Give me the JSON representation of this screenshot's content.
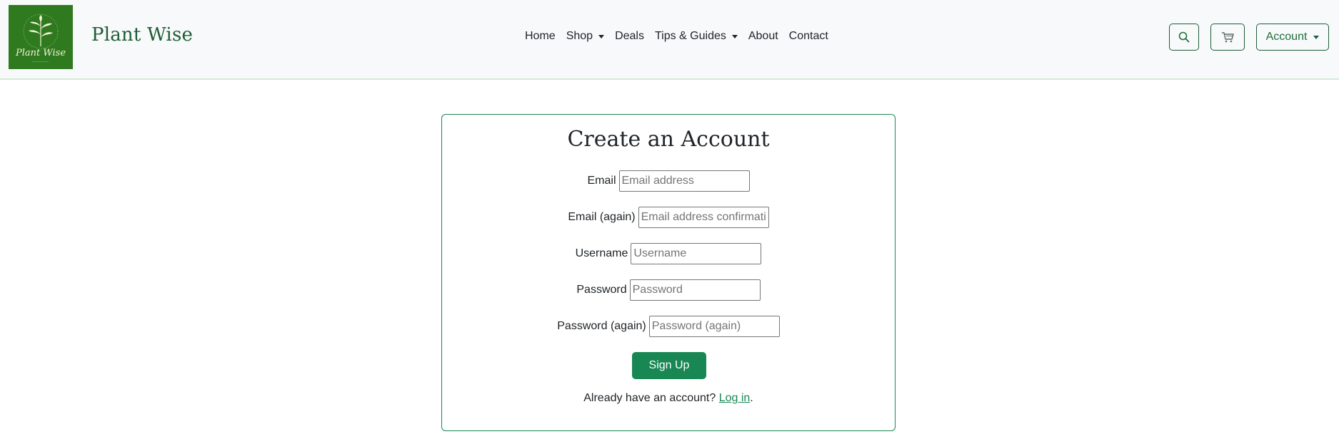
{
  "header": {
    "brand": "Plant Wise",
    "logo_text": "Plant Wise",
    "nav": [
      {
        "label": "Home"
      },
      {
        "label": "Shop"
      },
      {
        "label": "Deals"
      },
      {
        "label": "Tips & Guides"
      },
      {
        "label": "About"
      },
      {
        "label": "Contact"
      }
    ],
    "account_label": "Account",
    "icons": {
      "search": "search-icon",
      "cart": "cart-icon"
    },
    "colors": {
      "nav_bg": "#f8f9fa",
      "brand": "#1f5d36",
      "accent": "#198754",
      "logo_bg": "#2f7a1f"
    }
  },
  "form": {
    "title": "Create an Account",
    "fields": [
      {
        "label": "Email",
        "placeholder": "Email address"
      },
      {
        "label": "Email (again)",
        "placeholder": "Email address confirmation"
      },
      {
        "label": "Username",
        "placeholder": "Username"
      },
      {
        "label": "Password",
        "placeholder": "Password"
      },
      {
        "label": "Password (again)",
        "placeholder": "Password (again)"
      }
    ],
    "submit_label": "Sign Up",
    "login_prompt": "Already have an account? ",
    "login_link": "Log in",
    "login_suffix": "."
  }
}
